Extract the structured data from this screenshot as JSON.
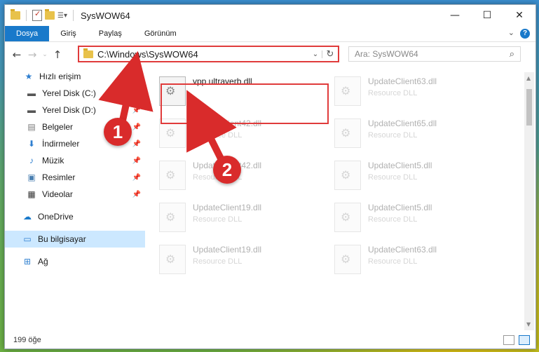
{
  "window": {
    "title": "SysWOW64"
  },
  "ribbon": {
    "tabs": [
      "Dosya",
      "Giriş",
      "Paylaş",
      "Görünüm"
    ],
    "help": "?"
  },
  "address": {
    "path": "C:\\Windows\\SysWOW64",
    "search_placeholder": "Ara: SysWOW64"
  },
  "sidebar": {
    "items": [
      {
        "label": "Hızlı erişim",
        "icon": "star-icon"
      },
      {
        "label": "Yerel Disk (C:)",
        "icon": "drive-icon",
        "pinned": true
      },
      {
        "label": "Yerel Disk (D:)",
        "icon": "drive-icon",
        "pinned": true
      },
      {
        "label": "Belgeler",
        "icon": "documents-icon",
        "pinned": true
      },
      {
        "label": "İndirmeler",
        "icon": "download-icon",
        "pinned": true
      },
      {
        "label": "Müzik",
        "icon": "music-icon",
        "pinned": true
      },
      {
        "label": "Resimler",
        "icon": "pictures-icon",
        "pinned": true
      },
      {
        "label": "Videolar",
        "icon": "video-icon",
        "pinned": true
      },
      {
        "label": "OneDrive",
        "icon": "cloud-icon"
      },
      {
        "label": "Bu bilgisayar",
        "icon": "computer-icon",
        "selected": true
      },
      {
        "label": "Ağ",
        "icon": "network-icon"
      }
    ]
  },
  "files": [
    {
      "name": "vpp ultraverb.dll",
      "type": ""
    },
    {
      "name": "UpdateClient63.dll",
      "type": "Resource DLL"
    },
    {
      "name": "UpdateClient42.dll",
      "type": "Resource DLL"
    },
    {
      "name": "UpdateClient65.dll",
      "type": "Resource DLL"
    },
    {
      "name": "UpdateClient42.dll",
      "type": "Resource DLL"
    },
    {
      "name": "UpdateClient5.dll",
      "type": "Resource DLL"
    },
    {
      "name": "UpdateClient19.dll",
      "type": "Resource DLL"
    },
    {
      "name": "UpdateClient5.dll",
      "type": "Resource DLL"
    },
    {
      "name": "UpdateClient19.dll",
      "type": "Resource DLL"
    },
    {
      "name": "UpdateClient63.dll",
      "type": "Resource DLL"
    }
  ],
  "status": {
    "count": "199 öğe"
  },
  "annotations": {
    "badge1": "1",
    "badge2": "2",
    "color": "#d92b2b"
  }
}
